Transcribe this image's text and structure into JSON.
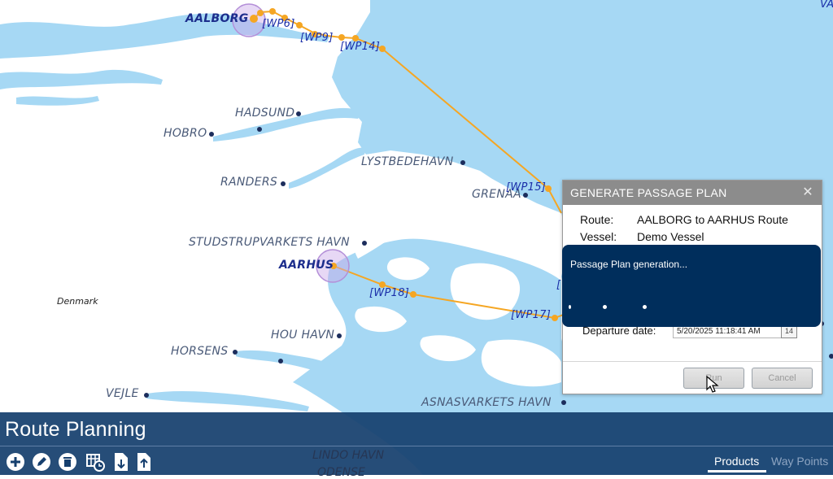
{
  "map": {
    "country_label": "Denmark",
    "ports": [
      {
        "id": "aalborg",
        "name": "AALBORG"
      },
      {
        "id": "aarhus",
        "name": "AARHUS"
      },
      {
        "id": "hadsund",
        "name": "HADSUND"
      },
      {
        "id": "hobro",
        "name": "HOBRO"
      },
      {
        "id": "randers",
        "name": "RANDERS"
      },
      {
        "id": "lystbedehavn",
        "name": "LYSTBEDEHAVN"
      },
      {
        "id": "grenaa",
        "name": "GRENAA"
      },
      {
        "id": "studstrup",
        "name": "STUDSTRUPVARKETS HAVN"
      },
      {
        "id": "hou",
        "name": "HOU HAVN"
      },
      {
        "id": "horsens",
        "name": "HORSENS"
      },
      {
        "id": "vejle",
        "name": "VEJLE"
      },
      {
        "id": "asnas",
        "name": "ASNASVARKETS HAVN"
      },
      {
        "id": "lindo",
        "name": "LINDO HAVN"
      },
      {
        "id": "odense",
        "name": "ODENSE"
      }
    ],
    "waypoints": [
      "[WP6]",
      "[WP9]",
      "[WP14]",
      "[WP15]",
      "[WP18]",
      "[WP17]",
      "[",
      "VA"
    ],
    "colors": {
      "sea": "#a6d8f4",
      "land": "#ffffff",
      "route": "#f5a623",
      "port_marker": "#1c2d5c",
      "port_circle": "#c9a8e8"
    }
  },
  "dialog": {
    "title": "GENERATE PASSAGE PLAN",
    "close_glyph": "✕",
    "route_label": "Route:",
    "route_value": "AALBORG to AARHUS Route",
    "vessel_label": "Vessel:",
    "vessel_value": "Demo Vessel",
    "departure_label": "Departure date:",
    "departure_value": "5/20/2025 11:18:41 AM",
    "calendar_icon_text": "14",
    "run_label": "Run",
    "cancel_label": "Cancel"
  },
  "overlay": {
    "message": "Passage Plan generation...",
    "color": "#002e5c"
  },
  "panel": {
    "title": "Route Planning",
    "toolbar": [
      "add-icon",
      "edit-icon",
      "delete-icon",
      "schedule-icon",
      "import-icon",
      "export-icon"
    ],
    "tabs": [
      {
        "label": "Products",
        "active": true
      },
      {
        "label": "Way Points",
        "active": false
      }
    ],
    "color": "#163f6e"
  }
}
